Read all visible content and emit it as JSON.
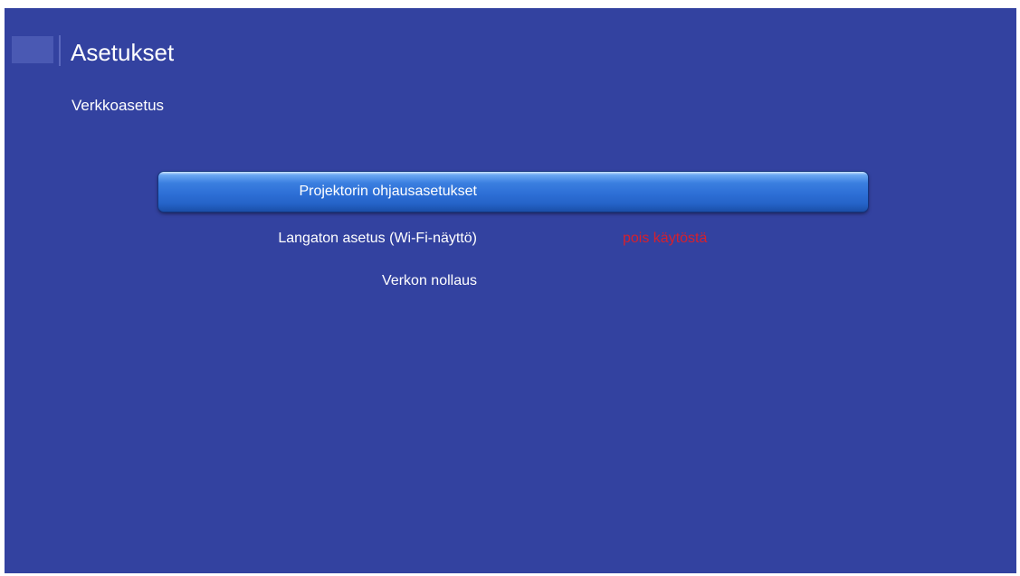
{
  "header": {
    "title": "Asetukset",
    "logo_icon": "settings-logo-icon"
  },
  "section": {
    "title": "Verkkoasetus"
  },
  "menu": {
    "items": [
      {
        "label": "Projektorin ohjausasetukset",
        "value": "",
        "selected": true
      },
      {
        "label": "Langaton asetus (Wi-Fi-näyttö)",
        "value": "pois käytöstä",
        "selected": false
      },
      {
        "label": "Verkon nollaus",
        "value": "",
        "selected": false
      }
    ]
  },
  "colors": {
    "background": "#3342a0",
    "selection": "#2d6fd6",
    "value_disabled": "#d6202d",
    "text": "#ffffff"
  }
}
